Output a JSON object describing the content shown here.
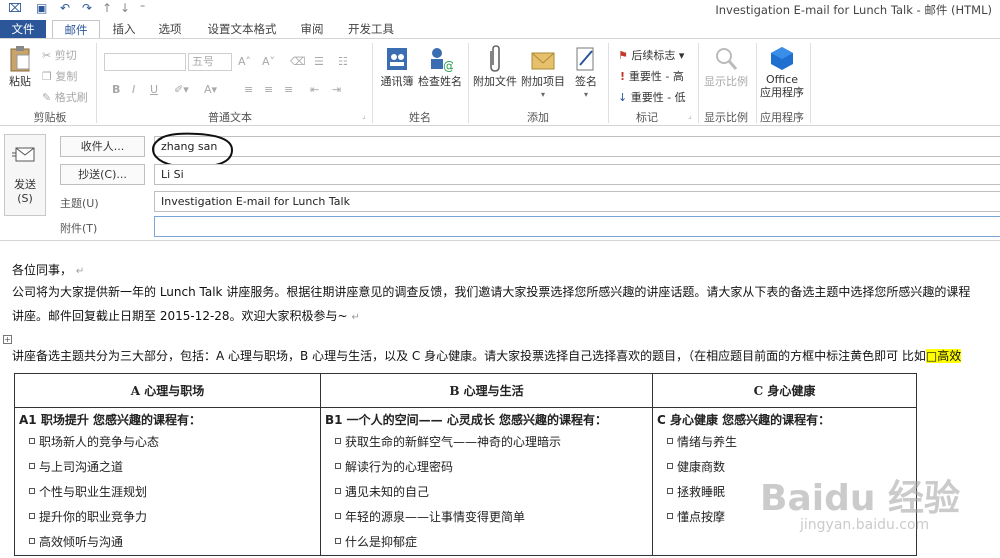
{
  "window": {
    "title": "Investigation E-mail for Lunch Talk - 邮件 (HTML)"
  },
  "tabs": [
    {
      "label": "文件"
    },
    {
      "label": "邮件"
    },
    {
      "label": "插入"
    },
    {
      "label": "选项"
    },
    {
      "label": "设置文本格式"
    },
    {
      "label": "审阅"
    },
    {
      "label": "开发工具"
    }
  ],
  "ribbon": {
    "clipboard": {
      "paste": "粘贴",
      "cut": "剪切",
      "copy": "复制",
      "format_painter": "格式刷",
      "group": "剪贴板"
    },
    "basic_text": {
      "font_size": "五号",
      "grow": "A˄",
      "shrink": "A˅",
      "bold": "B",
      "italic": "I",
      "underline": "U",
      "group": "普通文本"
    },
    "names": {
      "address_book": "通讯簿",
      "check_names": "检查姓名",
      "group": "姓名"
    },
    "include": {
      "attach_file": "附加文件",
      "attach_item": "附加项目",
      "signature": "签名",
      "group": "添加"
    },
    "tags": {
      "follow_up": "后续标志",
      "high": "重要性 - 高",
      "low": "重要性 - 低",
      "group": "标记"
    },
    "zoom": {
      "zoom": "显示比例",
      "group": "显示比例"
    },
    "apps": {
      "office_apps_1": "Office",
      "office_apps_2": "应用程序",
      "group": "应用程序"
    }
  },
  "compose": {
    "send": "发送",
    "send_key": "(S)",
    "to_button": "收件人...",
    "to_value": "zhang san",
    "cc_button": "抄送(C)...",
    "cc_value": "Li Si",
    "subject_label": "主题(U)",
    "subject_value": "Investigation E-mail for Lunch Talk",
    "attach_label": "附件(T)",
    "attach_value": ""
  },
  "body": {
    "greeting": "各位同事，",
    "p1": "公司将为大家提供新一年的 Lunch Talk 讲座服务。根据往期讲座意见的调查反馈，我们邀请大家投票选择您所感兴趣的讲座话题。请大家从下表的备选主题中选择您所感兴趣的课程",
    "p2": "讲座。邮件回复截止日期至 2015-12-28。欢迎大家积极参与~",
    "p3": "讲座备选主题共分为三大部分，包括：A 心理与职场，B 心理与生活，以及 C 身心健康。请大家投票选择自己选择喜欢的题目，（在相应题目前面的方框中标注黄色即可 比如",
    "p3_highlight": "□高效",
    "para_mark": "↵"
  },
  "table": {
    "headers": [
      "A  心理与职场",
      "B  心理与生活",
      "C  身心健康"
    ],
    "subheads": [
      "A1 职场提升 您感兴趣的课程有：",
      "B1 一个人的空间—— 心灵成长 您感兴趣的课程有：",
      "C 身心健康 您感兴趣的课程有："
    ],
    "col_a": [
      "职场新人的竞争与心态",
      "与上司沟通之道",
      "个性与职业生涯规划",
      "提升你的职业竞争力",
      "高效倾听与沟通"
    ],
    "col_b": [
      "获取生命的新鲜空气——神奇的心理暗示",
      "解读行为的心理密码",
      "遇见未知的自己",
      "年轻的源泉——让事情变得更简单",
      "什么是抑郁症"
    ],
    "col_c": [
      "情绪与养生",
      "健康商数",
      "拯救睡眠",
      "懂点按摩"
    ]
  },
  "watermark": {
    "brand": "Baidu 经验",
    "url": "jingyan.baidu.com"
  }
}
